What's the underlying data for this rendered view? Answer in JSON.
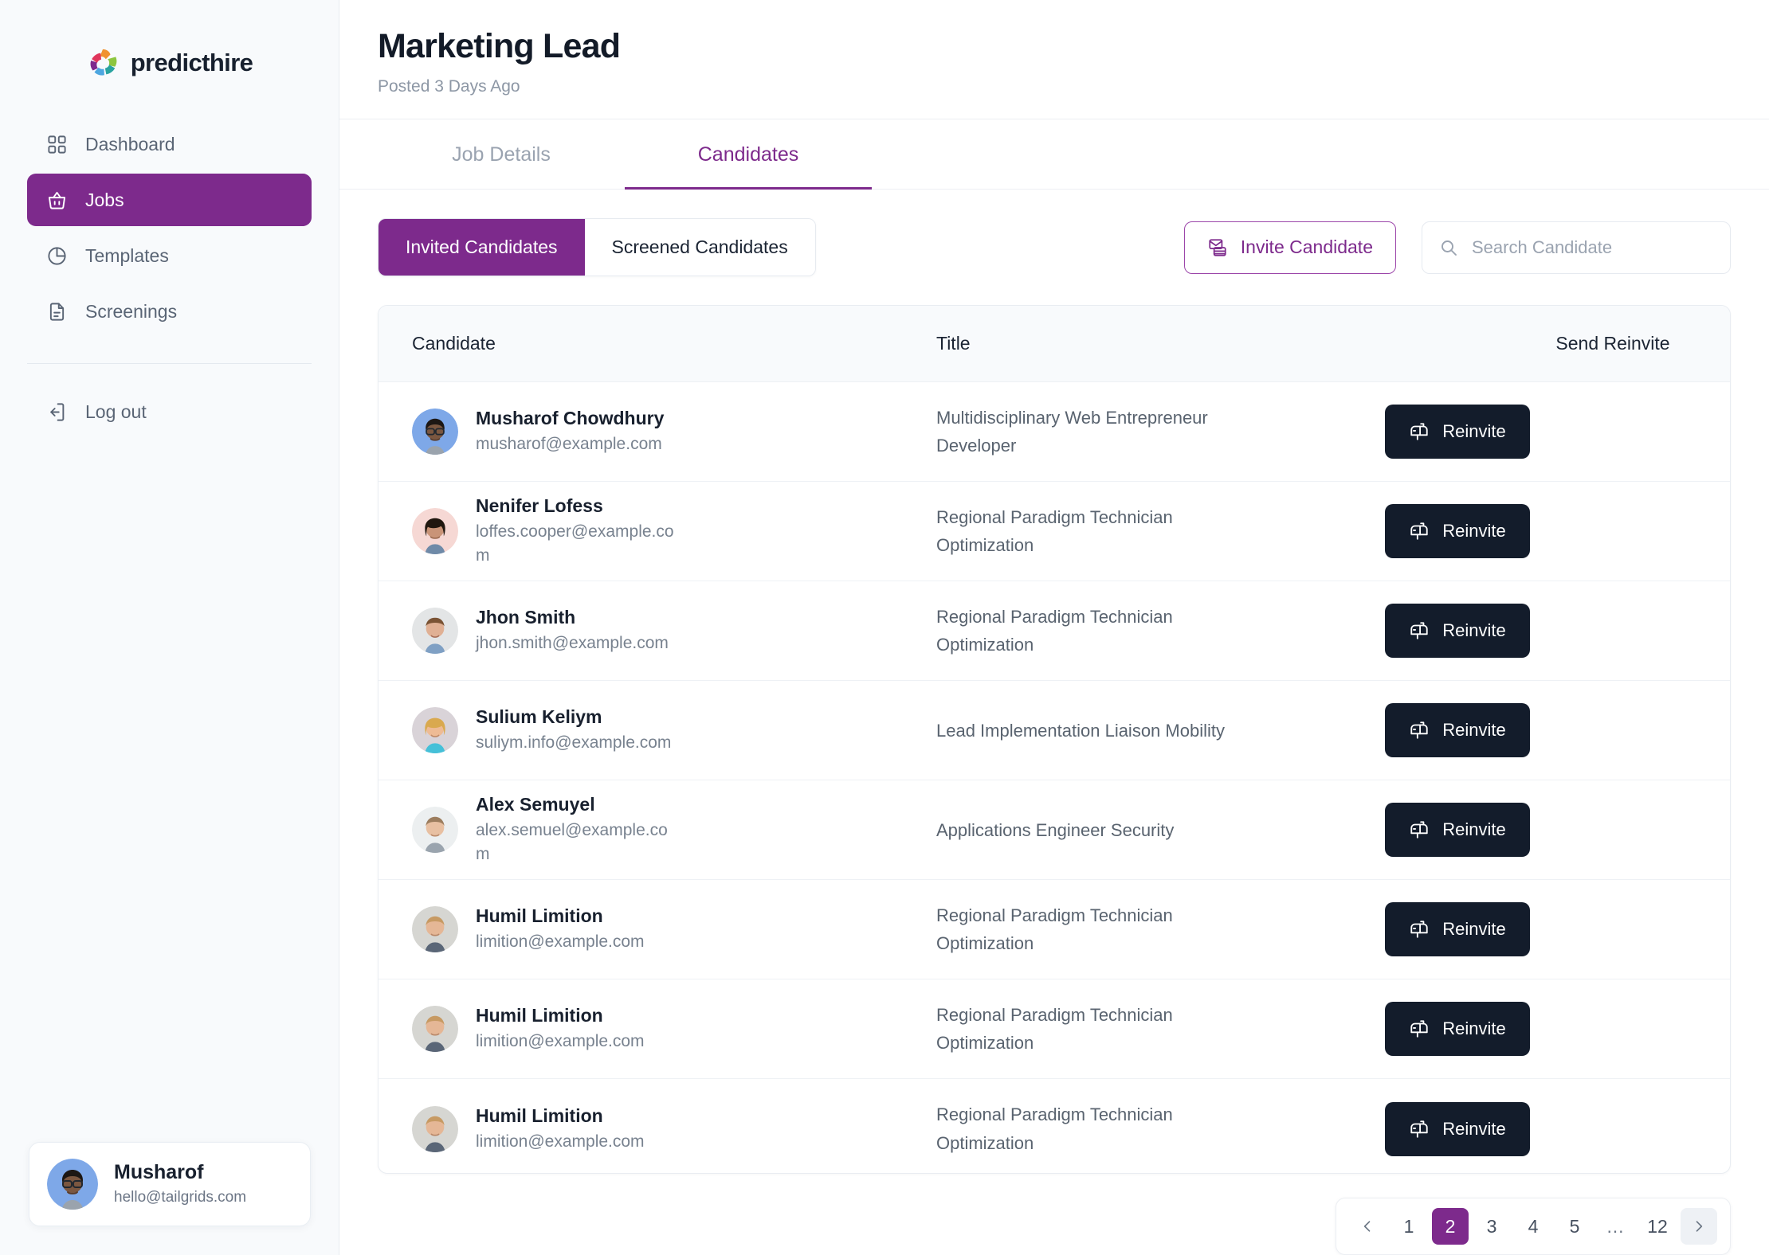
{
  "brand": {
    "name": "predicthire",
    "logo_icon": "pinwheel-logo-icon"
  },
  "sidebar": {
    "items": [
      {
        "label": "Dashboard",
        "icon": "grid-icon",
        "active": false
      },
      {
        "label": "Jobs",
        "icon": "basket-icon",
        "active": true
      },
      {
        "label": "Templates",
        "icon": "pie-chart-icon",
        "active": false
      },
      {
        "label": "Screenings",
        "icon": "document-icon",
        "active": false
      }
    ],
    "logout": {
      "label": "Log out",
      "icon": "logout-icon"
    },
    "user": {
      "name": "Musharof",
      "email": "hello@tailgrids.com",
      "avatar_icon": "user-avatar"
    }
  },
  "header": {
    "title": "Marketing Lead",
    "subtitle": "Posted 3 Days Ago"
  },
  "tabs": [
    {
      "label": "Job Details",
      "active": false
    },
    {
      "label": "Candidates",
      "active": true
    }
  ],
  "toolbar": {
    "segments": [
      {
        "label": "Invited Candidates",
        "active": true
      },
      {
        "label": "Screened Candidates",
        "active": false
      }
    ],
    "invite_button": {
      "label": "Invite Candidate",
      "icon": "invite-envelope-icon"
    },
    "search": {
      "value": "",
      "placeholder": "Search Candidate",
      "icon": "search-icon"
    }
  },
  "table": {
    "columns": [
      "Candidate",
      "Title",
      "Send Reinvite"
    ],
    "action_label": "Reinvite",
    "action_icon": "mailbox-icon",
    "rows": [
      {
        "name": "Musharof Chowdhury",
        "email": "musharof@example.com",
        "title": "Multidisciplinary Web Entrepreneur Developer",
        "action": "Reinvite"
      },
      {
        "name": "Nenifer Lofess",
        "email": "loffes.cooper@example.com",
        "title": "Regional Paradigm Technician Optimization",
        "action": "Reinvite"
      },
      {
        "name": "Jhon Smith",
        "email": "jhon.smith@example.com",
        "title": "Regional Paradigm Technician Optimization",
        "action": "Reinvite"
      },
      {
        "name": "Sulium Keliym",
        "email": "suliym.info@example.com",
        "title": "Lead Implementation Liaison Mobility",
        "action": "Reinvite"
      },
      {
        "name": "Alex Semuyel",
        "email": "alex.semuel@example.com",
        "title": "Applications Engineer Security",
        "action": "Reinvite"
      },
      {
        "name": "Humil Limition",
        "email": "limition@example.com",
        "title": "Regional Paradigm Technician Optimization",
        "action": "Reinvite"
      },
      {
        "name": "Humil Limition",
        "email": "limition@example.com",
        "title": "Regional Paradigm Technician Optimization",
        "action": "Reinvite"
      },
      {
        "name": "Humil Limition",
        "email": "limition@example.com",
        "title": "Regional Paradigm Technician Optimization",
        "action": "Reinvite"
      }
    ]
  },
  "pagination": {
    "prev_icon": "chevron-left-icon",
    "next_icon": "chevron-right-icon",
    "pages": [
      "1",
      "2",
      "3",
      "4",
      "5",
      "…",
      "12"
    ],
    "current": "2"
  },
  "colors": {
    "accent": "#7d2a8c",
    "dark": "#131c2b",
    "sidebar_bg": "#f8fafc",
    "muted_text": "#78828f"
  }
}
